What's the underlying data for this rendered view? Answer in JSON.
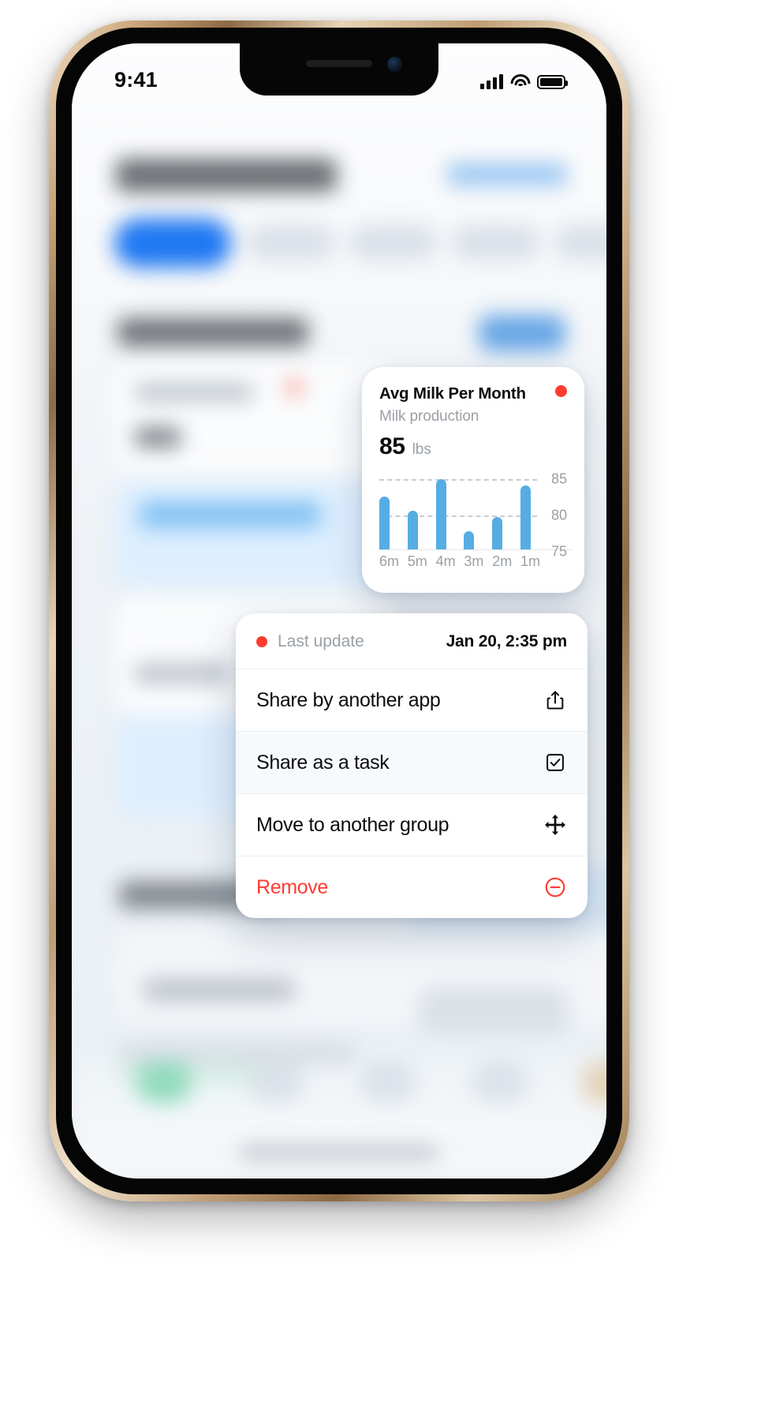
{
  "status_bar": {
    "time": "9:41",
    "cellular_icon": "signal-bars-icon",
    "wifi_icon": "wifi-icon",
    "battery_icon": "battery-full-icon"
  },
  "widget": {
    "title": "Avg Milk Per Month",
    "subtitle": "Milk production",
    "value": "85",
    "unit": "lbs",
    "alert_dot_color": "#ff3b30",
    "bar_color": "#56ade3"
  },
  "chart_data": {
    "type": "bar",
    "title": "Avg Milk Per Month",
    "subtitle": "Milk production",
    "xlabel": "",
    "ylabel": "lbs",
    "categories": [
      "6m",
      "5m",
      "4m",
      "3m",
      "2m",
      "1m"
    ],
    "values": [
      81.5,
      79.5,
      85.5,
      76.5,
      78.5,
      84.5
    ],
    "ylim": [
      74,
      87
    ],
    "yticks": [
      85,
      80,
      75
    ],
    "ytick_labels": [
      "85",
      "80",
      "75"
    ],
    "grid": true,
    "gridlines_at": [
      85,
      80
    ],
    "legend": "none",
    "bar_color": "#56ade3",
    "current_value": 85,
    "unit": "lbs"
  },
  "sheet": {
    "last_update_label": "Last update",
    "last_update_value": "Jan 20, 2:35 pm",
    "status_dot_color": "#ff3b30",
    "items": [
      {
        "label": "Share by another app",
        "icon": "share-icon",
        "selected": false,
        "danger": false
      },
      {
        "label": "Share as a task",
        "icon": "checkbox-icon",
        "selected": true,
        "danger": false
      },
      {
        "label": "Move to another group",
        "icon": "move-arrows-icon",
        "selected": false,
        "danger": false
      },
      {
        "label": "Remove",
        "icon": "remove-circle-icon",
        "selected": false,
        "danger": true
      }
    ]
  }
}
